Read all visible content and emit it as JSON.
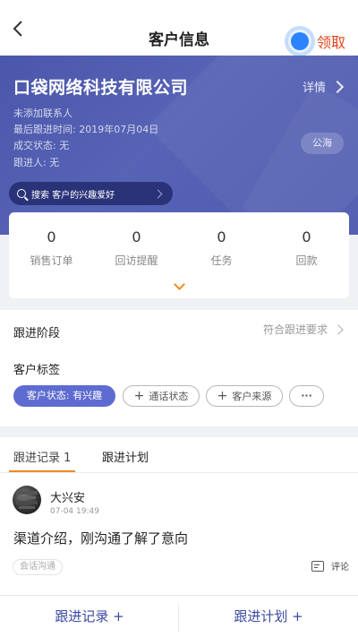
{
  "header": {
    "title": "客户信息",
    "claim_label": "领取",
    "accent_color": "#e3451d"
  },
  "customer": {
    "company": "口袋网络科技有限公司",
    "detail_label": "详情",
    "contact": "未添加联系人",
    "last_follow": "最后跟进时间: 2019年07月04日",
    "deal_status": "成交状态: 无",
    "follower": "跟进人: 无",
    "pool_label": "公海",
    "search_text": "搜索 客户的兴趣爱好"
  },
  "stats": [
    {
      "value": "0",
      "label": "销售订单"
    },
    {
      "value": "0",
      "label": "回访提醒"
    },
    {
      "value": "0",
      "label": "任务"
    },
    {
      "value": "0",
      "label": "回款"
    }
  ],
  "stage": {
    "label": "跟进阶段",
    "value": "符合跟进要求"
  },
  "tags": {
    "label": "客户标签",
    "active": "客户状态: 有兴趣",
    "items": [
      "通话状态",
      "客户来源"
    ],
    "more": "···"
  },
  "tabs": {
    "records": "跟进记录 1",
    "plans": "跟进计划"
  },
  "record": {
    "user": "大兴安",
    "time": "07-04 19:49",
    "content": "渠道介绍，刚沟通了解了意向",
    "type": "会话沟通",
    "comment": "评论"
  },
  "bottom": {
    "add_record": "跟进记录 +",
    "add_plan": "跟进计划 +"
  },
  "theme": {
    "primary": "#4f5bb0",
    "tag_active": "#5e6bd1",
    "tab_underline": "#f08a22"
  }
}
